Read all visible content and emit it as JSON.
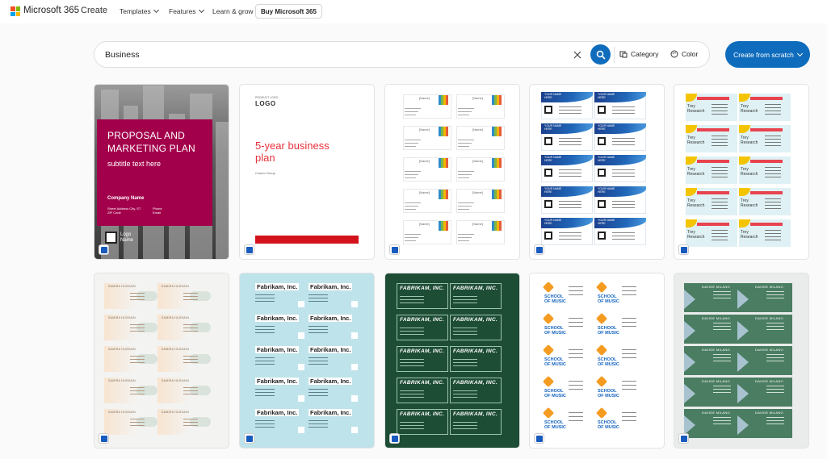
{
  "brand": {
    "name": "Microsoft 365",
    "logo_colors": [
      "#f25022",
      "#7fba00",
      "#00a4ef",
      "#ffb900"
    ]
  },
  "nav": {
    "create": "Create",
    "templates": "Templates",
    "features": "Features",
    "learn": "Learn & grow",
    "buy": "Buy Microsoft 365"
  },
  "search": {
    "value": "Business",
    "clear_icon": "close-icon",
    "search_icon": "search-icon",
    "category_label": "Category",
    "category_icon": "category-icon",
    "color_label": "Color",
    "color_icon": "palette-icon"
  },
  "create_button": {
    "label": "Create from scratch"
  },
  "colors": {
    "accent": "#0f6cbd",
    "proposal_red": "#a3004b",
    "plan_red": "#d3131c",
    "word_blue": "#185abd"
  },
  "templates": [
    {
      "title": "PROPOSAL AND MARKETING PLAN",
      "subtitle": "subtitle text here",
      "company": "Company Name",
      "address": "Street Address City, ST ZIP Code",
      "contact": "Phone Email",
      "logo": "Logo Name"
    },
    {
      "logo_small": "PRODUCT LOGO",
      "logo": "LOGO",
      "title": "5-year business plan",
      "author": "Cosmo Group"
    },
    {
      "placeholder": "[Name]"
    },
    {
      "placeholder": "YOUR NAME HERE"
    },
    {
      "company": "Trey Research"
    },
    {
      "name": "SAMIRA HUSSAIN"
    },
    {
      "company": "Fabrikam, Inc."
    },
    {
      "company": "FABRIKAM, INC."
    },
    {
      "company": "SCHOOL OF MUSIC"
    },
    {
      "name": "DAVIDE MILANO"
    }
  ],
  "app_icon": "word-icon"
}
